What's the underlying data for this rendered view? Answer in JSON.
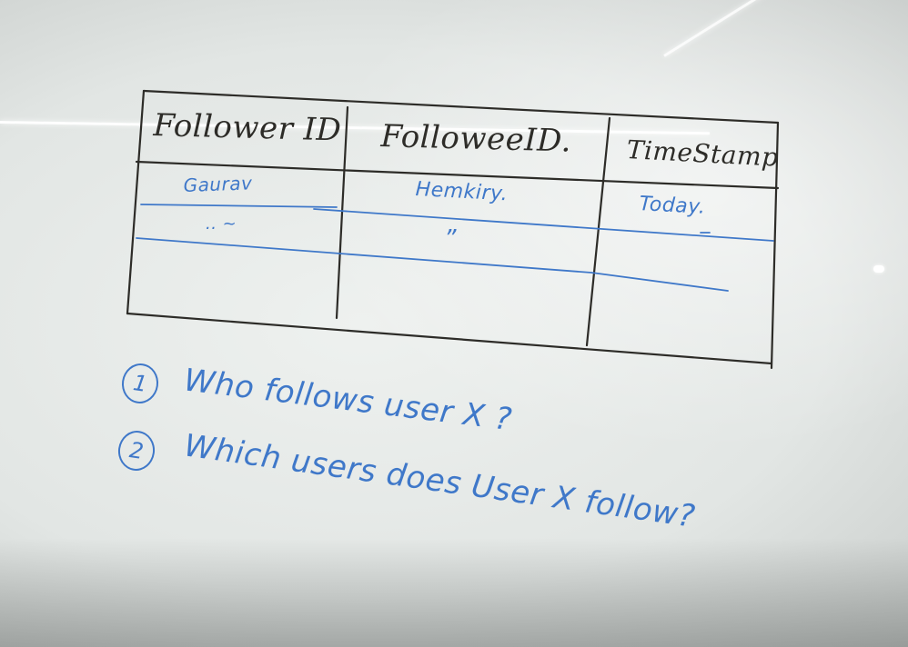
{
  "table": {
    "headers": [
      "Follower ID",
      "FolloweeID.",
      "TimeStamp"
    ],
    "rows": [
      [
        "Gaurav",
        "Hemkiry.",
        "Today."
      ],
      [
        ".. ~",
        "”",
        ""
      ]
    ]
  },
  "questions": [
    {
      "number": "1",
      "text": "Who follows user X ?"
    },
    {
      "number": "2",
      "text": "Which users does User X follow?"
    }
  ],
  "colors": {
    "board": "#e4e8e6",
    "marker_black": "#2d2c28",
    "marker_blue": "#3f78c9"
  }
}
